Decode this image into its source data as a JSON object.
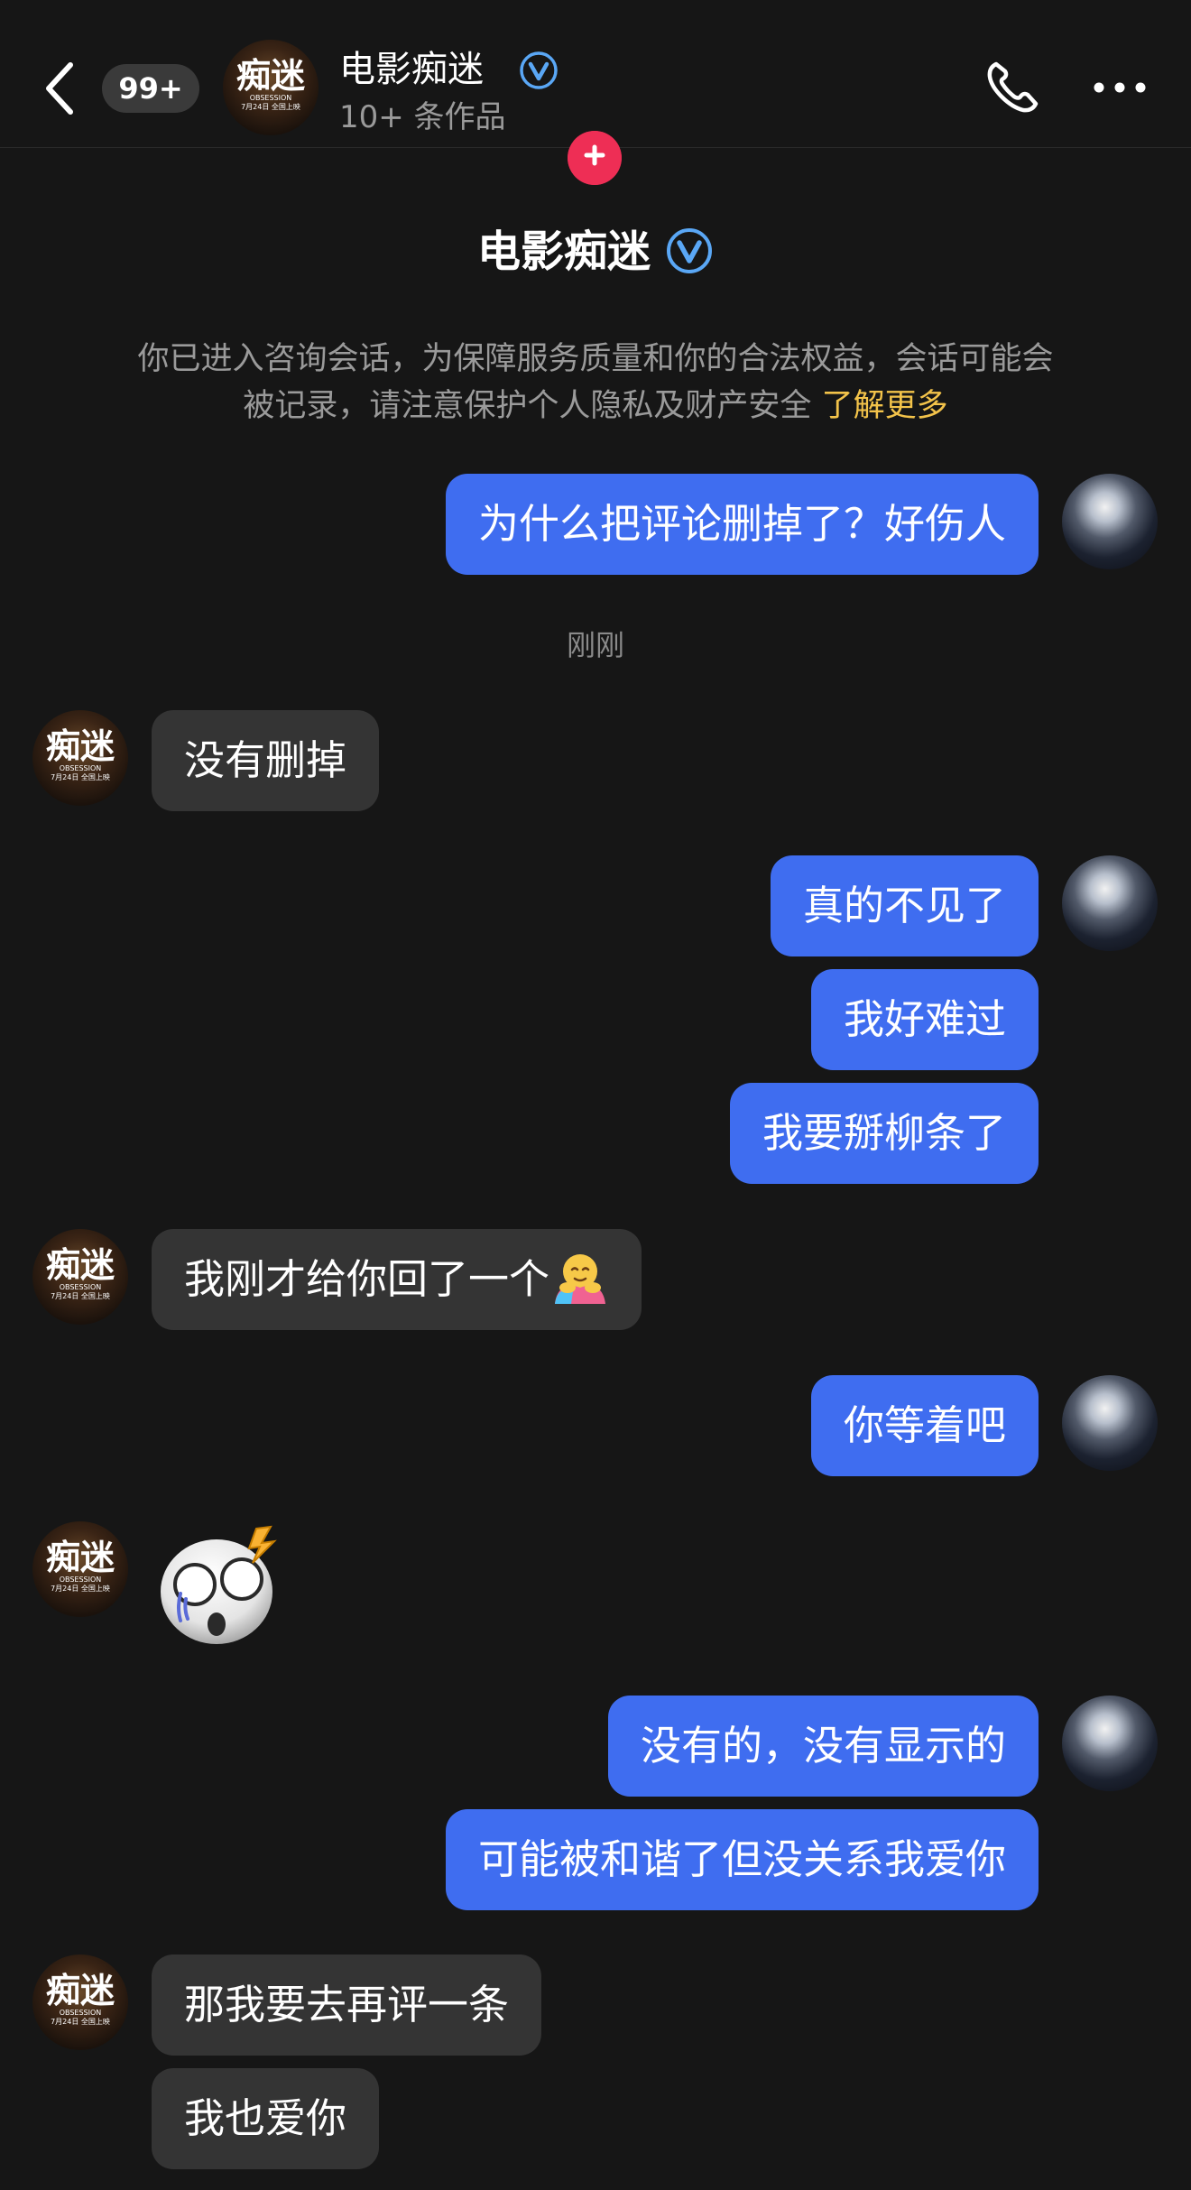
{
  "header": {
    "unread_badge": "99+",
    "contact_name": "电影痴迷",
    "subtitle": "10+ 条作品",
    "avatar_logo": {
      "title": "痴迷",
      "sub1": "OBSESSION",
      "sub2": "7月24日 全国上映"
    }
  },
  "profile": {
    "name": "电影痴迷",
    "notice_text": "你已进入咨询会话，为保障服务质量和你的合法权益，会话可能会被记录，请注意保护个人隐私及财产安全",
    "notice_link": "了解更多"
  },
  "timestamp": "刚刚",
  "messages": [
    {
      "from": "me",
      "text": "为什么把评论删掉了？好伤人"
    },
    {
      "from": "them",
      "text": "没有删掉"
    },
    {
      "from": "me",
      "text": "真的不见了"
    },
    {
      "from": "me",
      "text": "我好难过"
    },
    {
      "from": "me",
      "text": "我要掰柳条了"
    },
    {
      "from": "them",
      "text": "我刚才给你回了一个",
      "emoji": "hug-emoji"
    },
    {
      "from": "me",
      "text": "你等着吧"
    },
    {
      "from": "them",
      "emoji": "shocked-skull-emoji"
    },
    {
      "from": "me",
      "text": "没有的，没有显示的"
    },
    {
      "from": "me",
      "text": "可能被和谐了但没关系我爱你"
    },
    {
      "from": "them",
      "text": "那我要去再评一条"
    },
    {
      "from": "them",
      "text": "我也爱你"
    }
  ],
  "colors": {
    "background": "#161616",
    "outgoing_bubble": "#3f6df0",
    "incoming_bubble": "#343434",
    "accent_plus": "#ee2e55",
    "link": "#f3c34a",
    "verified": "#5aa7f5"
  }
}
